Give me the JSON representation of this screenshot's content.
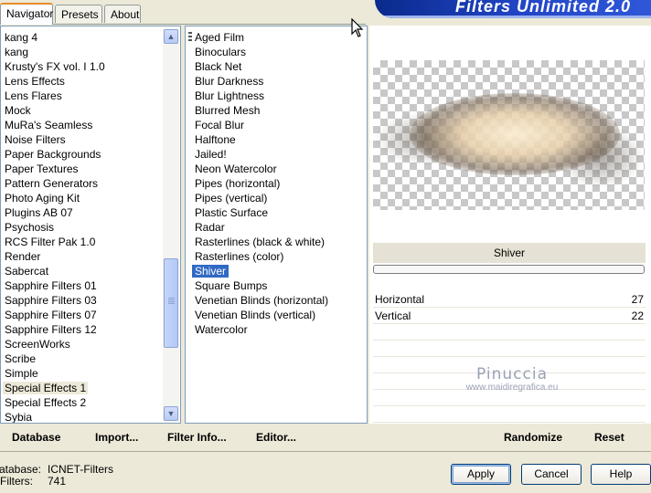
{
  "tabs": [
    "Navigator",
    "Presets",
    "About"
  ],
  "banner_title": "Filters Unlimited 2.0",
  "categories": [
    "kang 4",
    "kang",
    "Krusty's FX vol. I 1.0",
    "Lens Effects",
    "Lens Flares",
    "Mock",
    "MuRa's Seamless",
    "Noise Filters",
    "Paper Backgrounds",
    "Paper Textures",
    "Pattern Generators",
    "Photo Aging Kit",
    "Plugins AB 07",
    "Psychosis",
    "RCS Filter Pak 1.0",
    "Render",
    "Sabercat",
    "Sapphire Filters 01",
    "Sapphire Filters 03",
    "Sapphire Filters 07",
    "Sapphire Filters 12",
    "ScreenWorks",
    "Scribe",
    "Simple",
    "Special Effects 1",
    "Special Effects 2",
    "Sybia"
  ],
  "selected_category": "Special Effects 1",
  "filters": [
    "Aged Film",
    "Binoculars",
    "Black Net",
    "Blur Darkness",
    "Blur Lightness",
    "Blurred Mesh",
    "Focal Blur",
    "Halftone",
    "Jailed!",
    "Neon Watercolor",
    "Pipes (horizontal)",
    "Pipes (vertical)",
    "Plastic Surface",
    "Radar",
    "Rasterlines (black & white)",
    "Rasterlines (color)",
    "Shiver",
    "Square Bumps",
    "Venetian Blinds (horizontal)",
    "Venetian Blinds (vertical)",
    "Watercolor"
  ],
  "selected_filter": "Shiver",
  "filter_title": "Shiver",
  "params": [
    {
      "name": "Horizontal",
      "value": "27"
    },
    {
      "name": "Vertical",
      "value": "22"
    }
  ],
  "watermark": {
    "line1": "Pinuccia",
    "line2": "www.maidiregrafica.eu"
  },
  "bottom_buttons": {
    "database": "Database",
    "import": "Import...",
    "filter_info": "Filter Info...",
    "editor": "Editor...",
    "randomize": "Randomize",
    "reset": "Reset"
  },
  "info": {
    "database_label": "Database:",
    "database_value": "ICNET-Filters",
    "filters_label": "Filters:",
    "filters_value": "741"
  },
  "dialog_buttons": {
    "apply": "Apply",
    "cancel": "Cancel",
    "help": "Help"
  },
  "icons": [
    "scroll-up-icon",
    "scroll-down-icon",
    "mouse-cursor-icon"
  ]
}
